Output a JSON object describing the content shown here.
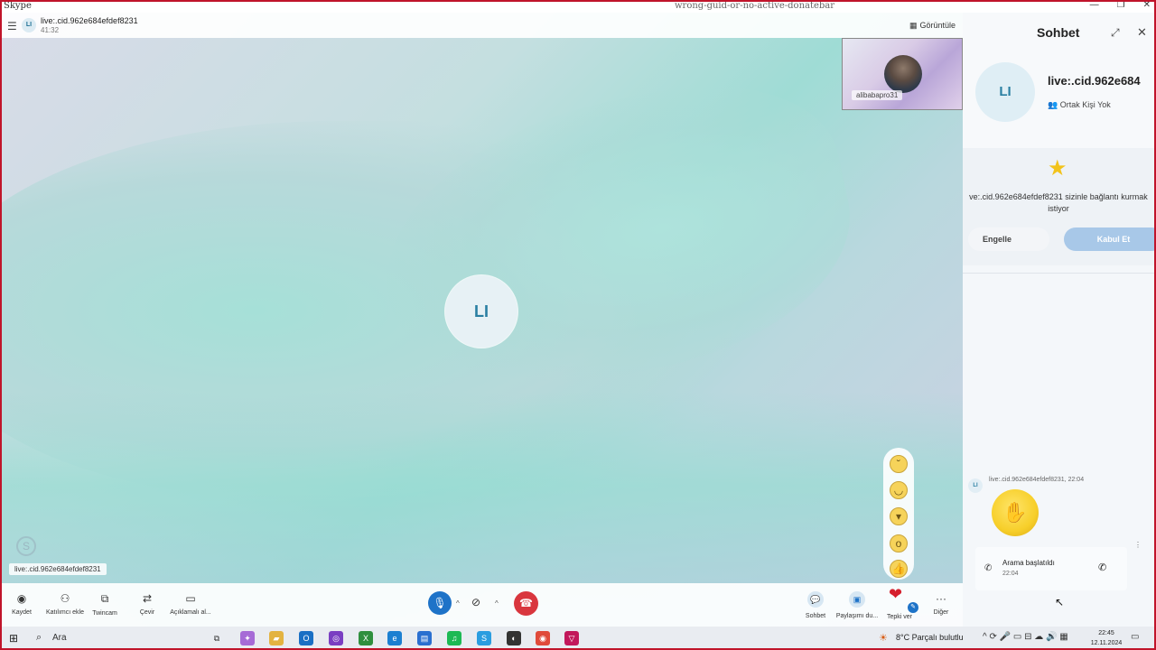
{
  "window": {
    "app": "Skype",
    "center_title": "wrong-guid-or-no-active-donatebar"
  },
  "call": {
    "title": "live:.cid.962e684efdef8231",
    "duration": "41:32",
    "initials": "LI",
    "view_label": "Görüntüle",
    "self_name": "alibabapro31",
    "name_tag": "live:.cid.962e684efdef8231"
  },
  "toolbar": {
    "record": "Kaydet",
    "add_participant": "Katılımcı ekle",
    "twincam": "Twincam",
    "translate": "Çevir",
    "captions": "Açıklamalı al...",
    "chat": "Sohbet",
    "share": "Paylaşımı du...",
    "react": "Tepki ver",
    "more": "Diğer"
  },
  "chat": {
    "title": "Sohbet",
    "initials": "LI",
    "contact_name": "live:.cid.962e684",
    "mutual": "Ortak Kişi Yok",
    "request_text": "ve:.cid.962e684efdef8231 sizinle bağlantı kurmak istiyor",
    "block_label": "Engelle",
    "accept_label": "Kabul Et",
    "message_meta": "live:.cid.962e684efdef8231, 22:04",
    "call_started": "Arama başlatıldı",
    "call_time": "22:04"
  },
  "taskbar": {
    "search": "Ara",
    "weather": "8°C  Parçalı bulutlu",
    "time": "22:45",
    "date": "12.11.2024"
  },
  "colors": {
    "accent": "#1e73c8",
    "end_call": "#d9363e",
    "frame": "#c0142a"
  }
}
